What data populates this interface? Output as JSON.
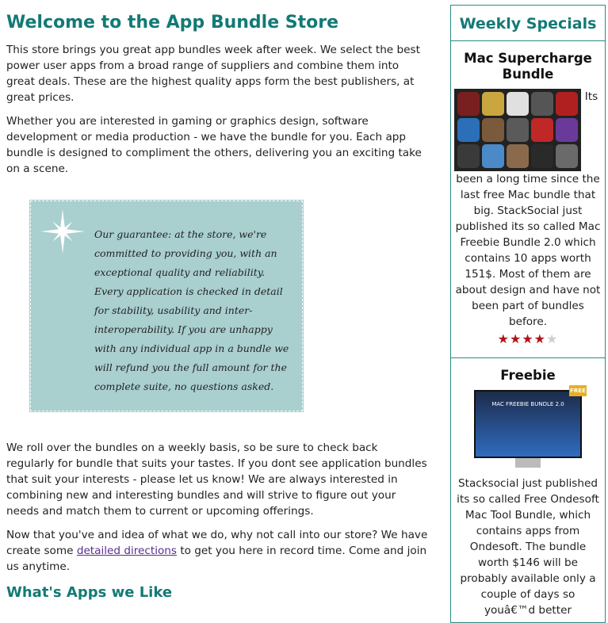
{
  "main": {
    "title": "Welcome to the App Bundle Store",
    "intro1": "This store brings you great app bundles week after week. We select the best power user apps from a broad range of suppliers and combine them into great deals. These are the highest quality apps form the best publishers, at great prices.",
    "intro2": "Whether you are interested in gaming or graphics design, software development or media production - we have the bundle for you. Each app bundle is designed to compliment the others, delivering you an exciting take on a scene.",
    "guarantee": "Our guarantee: at the store, we're committed to providing you, with an exceptional quality and reliability. Every application is checked in detail for stability, usability and inter-interoperability. If you are unhappy with any individual app in a bundle we will refund you the full amount for the complete suite, no questions asked.",
    "para3": "We roll over the bundles on a weekly basis, so be sure to check back regularly for bundle that suits your tastes. If you dont see application bundles that suit your interests - please let us know! We are always interested in combining new and interesting bundles and will strive to figure out your needs and match them to current or upcoming offerings.",
    "para4_before": "Now that you've and idea of what we do, why not call into our store? We have create some ",
    "para4_link": "detailed directions",
    "para4_after": " to get you here in record time. Come and join us anytime.",
    "subheading": "What's Apps we Like"
  },
  "sidebar": {
    "title": "Weekly Specials",
    "specials": [
      {
        "name": "Mac Supercharge Bundle",
        "description": "Its been a long time since the last free Mac bundle that big. StackSocial just published its so called Mac Freebie Bundle 2.0 which contains 10 apps worth 151$. Most of them are about design and have not been part of bundles before.",
        "rating": 3.5,
        "rating_max": 5
      },
      {
        "name": "Freebie",
        "image_text": "MAC FREEBIE BUNDLE 2.0",
        "image_badge": "FREE",
        "description": "Stacksocial just published its so called Free Ondesoft Mac Tool Bundle, which contains apps from Ondesoft. The bundle worth $146 will be probably available only a couple of days so youâ€™d better"
      }
    ],
    "icon_colors": [
      "#7a1f1f",
      "#c9a640",
      "#e0e0e0",
      "#555555",
      "#b02020",
      "#2a6fb8",
      "#7a5a3a",
      "#5a5a5a",
      "#c02828",
      "#6a3a9a",
      "#3a3a3a",
      "#4a8ac8",
      "#8a6a4a",
      "#2a2a2a",
      "#6a6a6a"
    ]
  }
}
